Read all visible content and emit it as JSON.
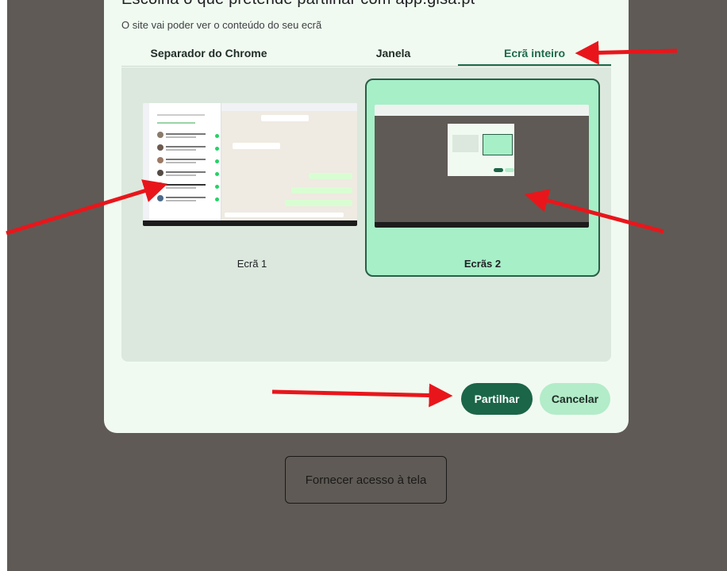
{
  "dialog": {
    "cut_title": "Escolha o que pretende partilhar com app.gisa.pt",
    "subtitle": "O site vai poder ver o conteúdo do seu ecrã",
    "tabs": [
      {
        "label": "Separador do Chrome",
        "selected": false
      },
      {
        "label": "Janela",
        "selected": false
      },
      {
        "label": "Ecrã inteiro",
        "selected": true
      }
    ],
    "screens": [
      {
        "label": "Ecrã 1",
        "selected": false
      },
      {
        "label": "Ecrãs 2",
        "selected": true
      }
    ],
    "share_label": "Partilhar",
    "cancel_label": "Cancelar"
  },
  "page": {
    "provide_access_label": "Fornecer acesso à tela"
  },
  "annotations": {
    "arrow_color": "#e8161b",
    "count": 5
  },
  "colors": {
    "accent": "#1b6548",
    "selected_card": "#a6efc7",
    "page_background": "#5f5a55",
    "dialog_background": "#f1faf1"
  }
}
